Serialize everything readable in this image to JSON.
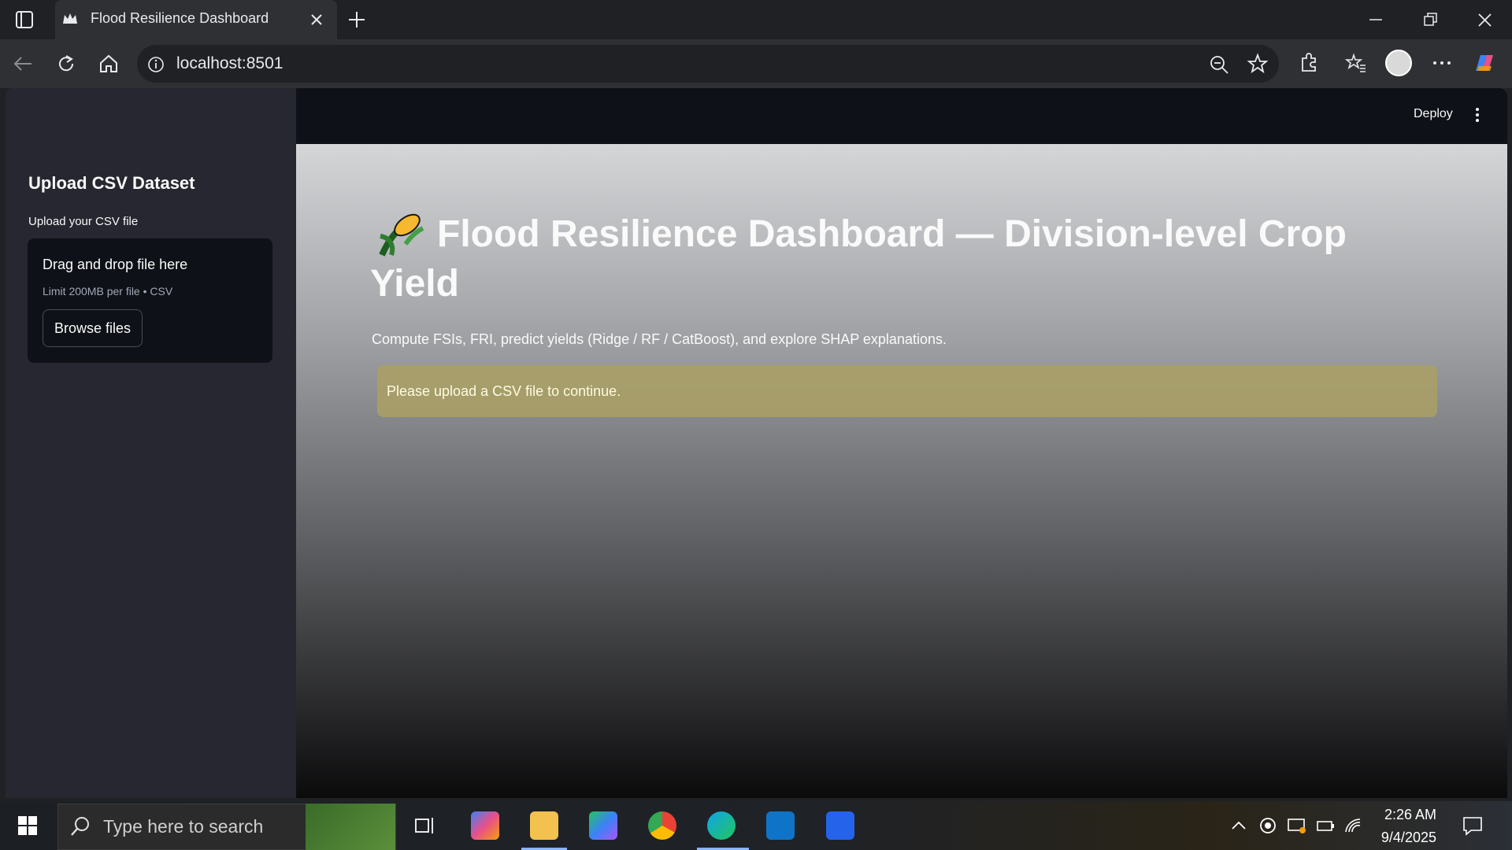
{
  "browser": {
    "tab_title": "Flood Resilience Dashboard",
    "url": "localhost:8501"
  },
  "app": {
    "deploy_label": "Deploy",
    "sidebar": {
      "title": "Upload CSV Dataset",
      "upload_label": "Upload your CSV file",
      "drop_text": "Drag and drop file here",
      "limit_text": "Limit 200MB per file • CSV",
      "browse_label": "Browse files"
    },
    "main": {
      "title_line1": "Flood Resilience Dashboard — Division-level Crop",
      "title_line2": "Yield",
      "caption": "Compute FSIs, FRI, predict yields (Ridge / RF / CatBoost), and explore SHAP explanations.",
      "warning": "Please upload a CSV file to continue."
    }
  },
  "taskbar": {
    "search_placeholder": "Type here to search",
    "time": "2:26 AM",
    "date": "9/4/2025"
  }
}
